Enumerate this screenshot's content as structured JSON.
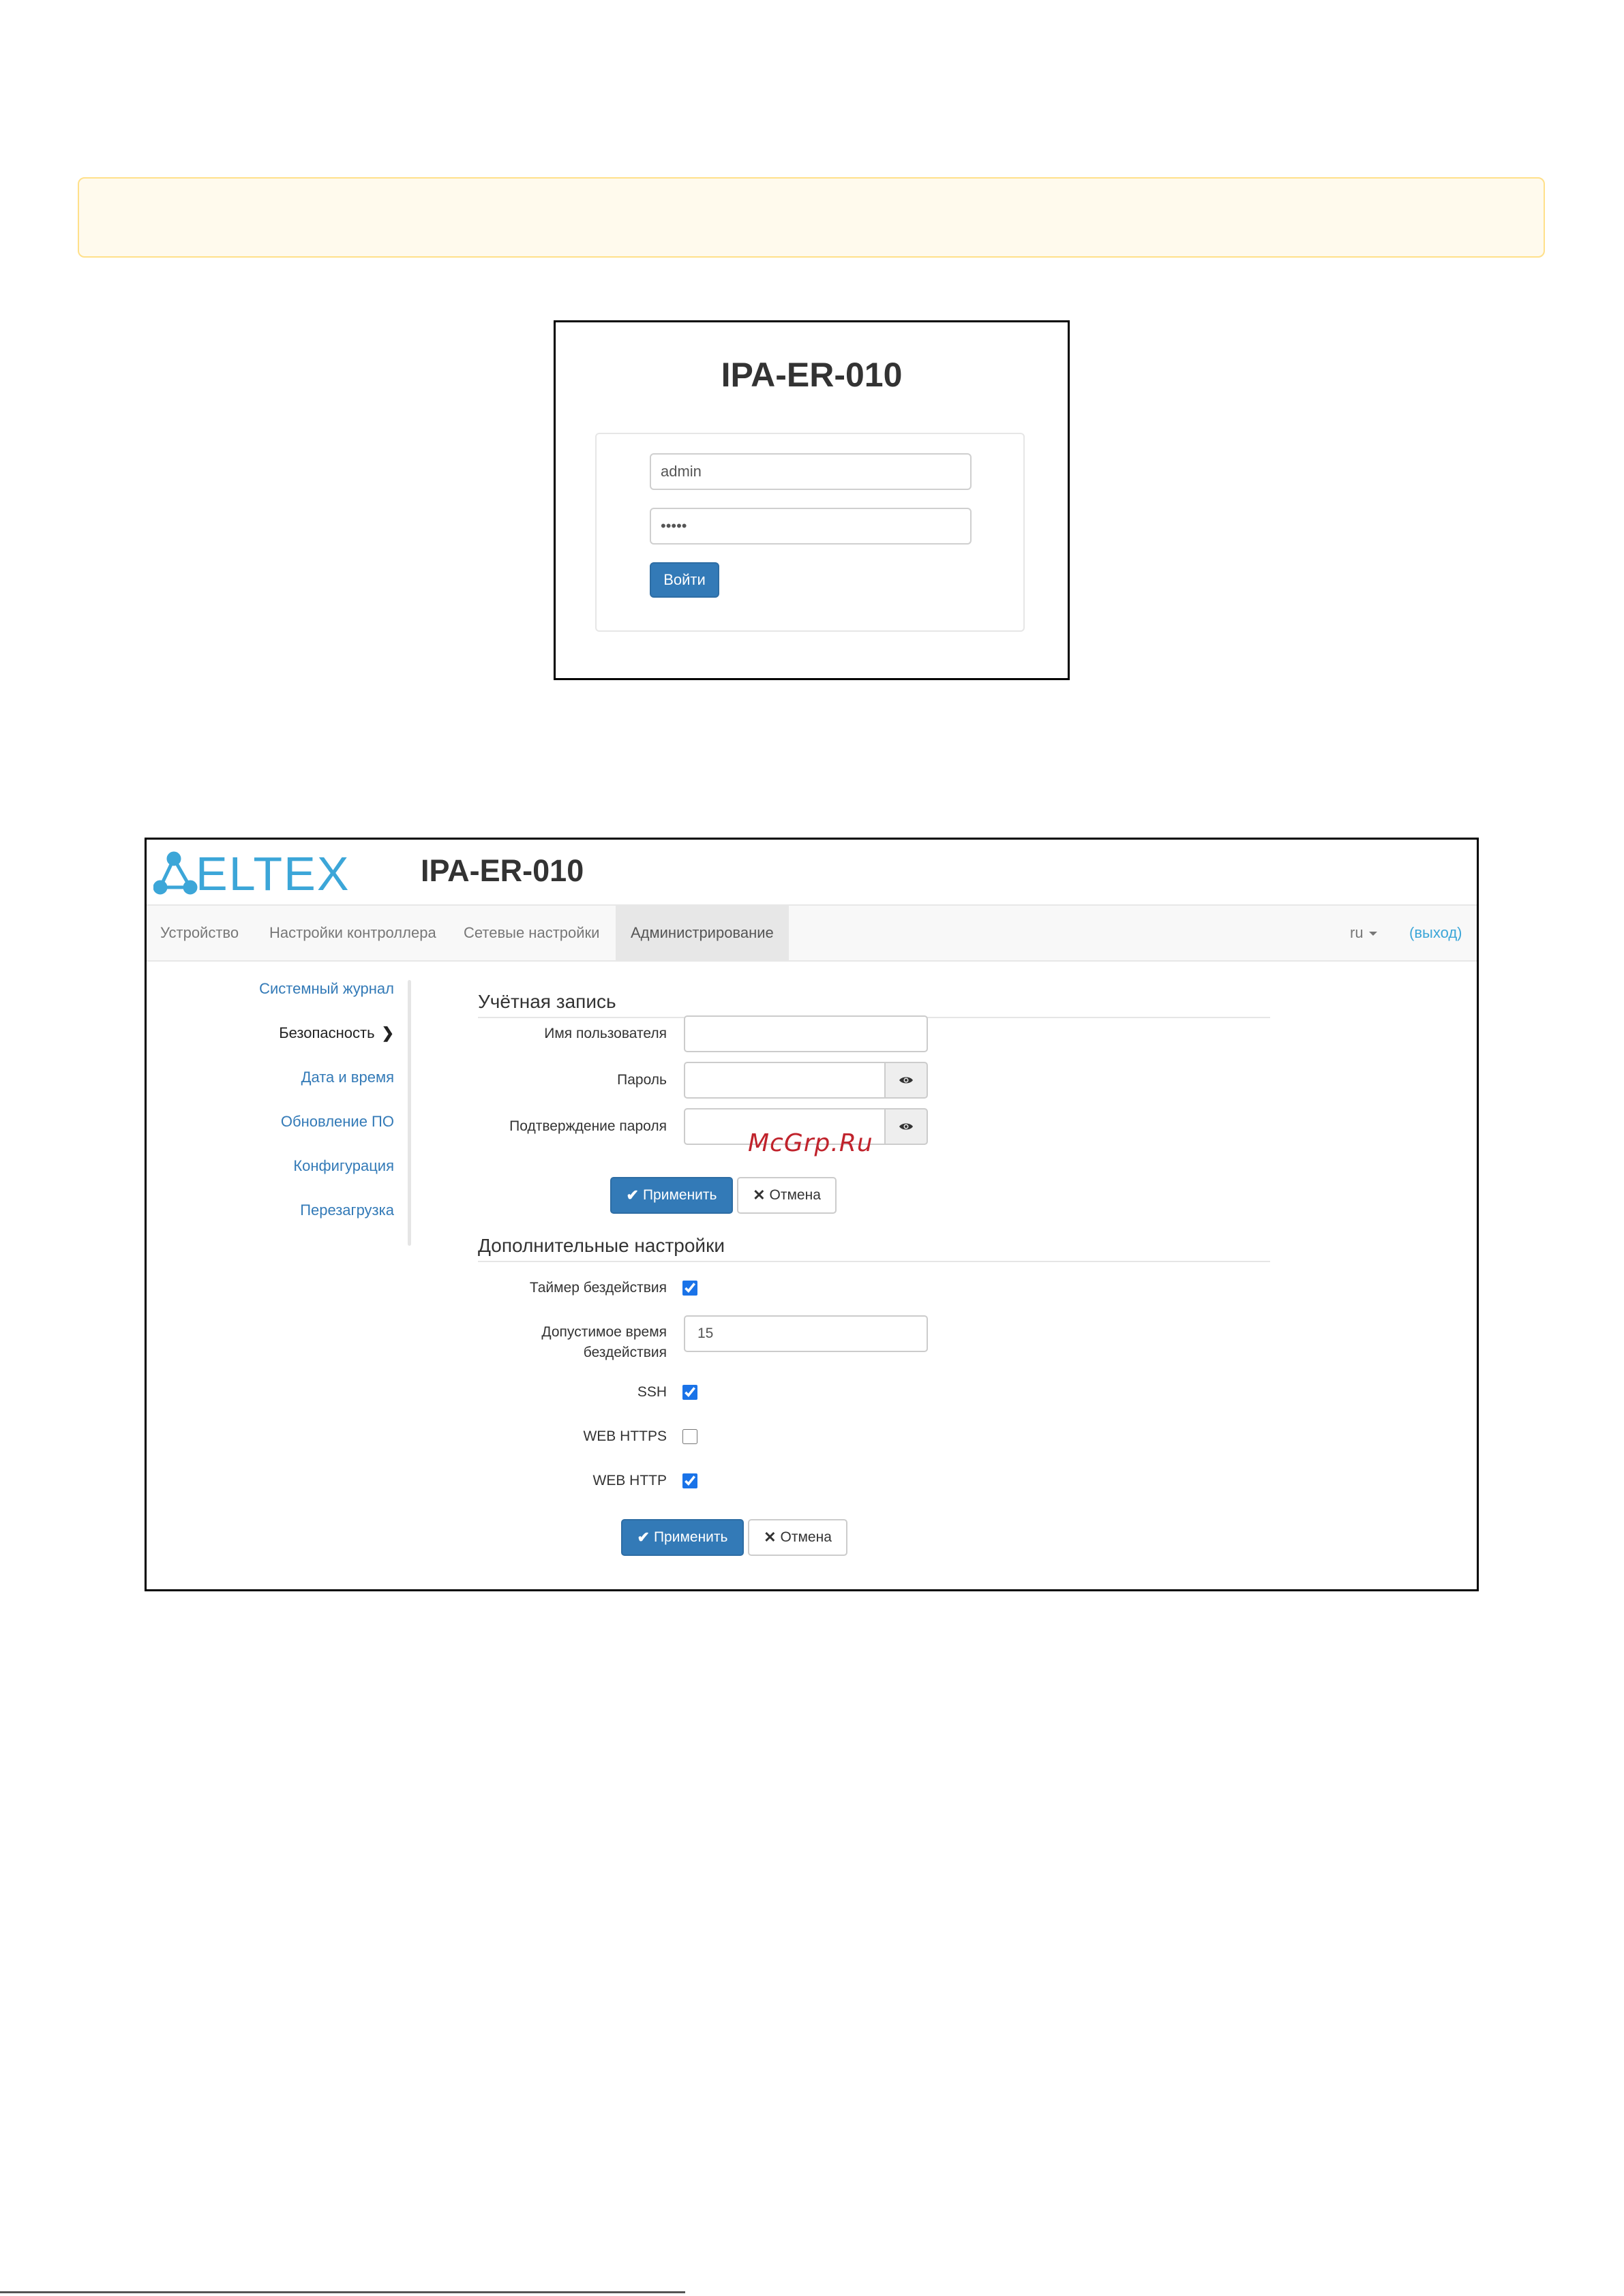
{
  "login": {
    "title": "IPA-ER-010",
    "username_value": "admin",
    "password_value": "•••••",
    "submit_label": "Войти"
  },
  "app": {
    "brand": "ELTEX",
    "title": "IPA-ER-010",
    "brand_color": "#3ca6d8",
    "nav": {
      "items": [
        "Устройство",
        "Настройки контроллера",
        "Сетевые настройки",
        "Администрирование"
      ],
      "active": "Администрирование",
      "language": "ru",
      "logout": "(выход)"
    },
    "sidebar": {
      "items": [
        "Системный журнал",
        "Безопасность",
        "Дата и время",
        "Обновление ПО",
        "Конфигурация",
        "Перезагрузка"
      ],
      "active": "Безопасность"
    },
    "account": {
      "title": "Учётная запись",
      "username_label": "Имя пользователя",
      "username_value": "",
      "password_label": "Пароль",
      "password_value": "",
      "confirm_label": "Подтверждение пароля",
      "confirm_value": "",
      "apply_label": "Применить",
      "cancel_label": "Отмена"
    },
    "additional": {
      "title": "Дополнительные настройки",
      "idle_timer_label": "Таймер бездействия",
      "idle_timer_checked": true,
      "idle_time_label_line1": "Допустимое время",
      "idle_time_label_line2": "бездействия",
      "idle_time_value": "15",
      "ssh_label": "SSH",
      "ssh_checked": true,
      "https_label": "WEB HTTPS",
      "https_checked": false,
      "http_label": "WEB HTTP",
      "http_checked": true,
      "apply_label": "Применить",
      "cancel_label": "Отмена"
    }
  },
  "watermark": "McGrp.Ru"
}
